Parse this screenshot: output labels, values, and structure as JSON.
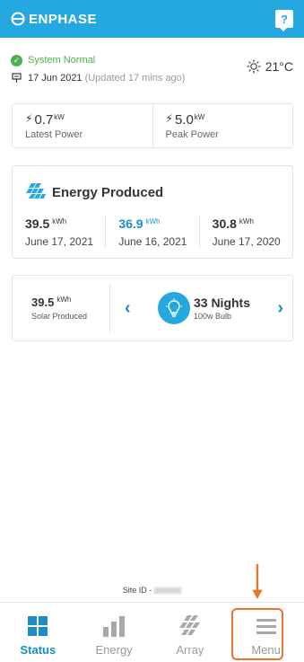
{
  "header": {
    "brand": "ENPHASE",
    "help_label": "?"
  },
  "status": {
    "text": "System Normal",
    "date": "17 Jun 2021",
    "updated": "(Updated 17 mins ago)",
    "temperature": "21°C"
  },
  "power": {
    "latest": {
      "value": "0.7",
      "unit": "kW",
      "label": "Latest Power"
    },
    "peak": {
      "value": "5.0",
      "unit": "kW",
      "label": "Peak Power"
    }
  },
  "energy": {
    "title": "Energy Produced",
    "items": [
      {
        "value": "39.5",
        "unit": "kWh",
        "date": "June 17, 2021"
      },
      {
        "value": "36.9",
        "unit": "kWh",
        "date": "June 16, 2021"
      },
      {
        "value": "30.8",
        "unit": "kWh",
        "date": "June 17, 2020"
      }
    ]
  },
  "equivalent": {
    "solar_value": "39.5",
    "solar_unit": "kWh",
    "solar_label": "Solar Produced",
    "nights": "33 Nights",
    "bulb": "100w Bulb"
  },
  "site": {
    "label": "Site ID -"
  },
  "nav": {
    "status": "Status",
    "energy": "Energy",
    "array": "Array",
    "menu": "Menu"
  },
  "colors": {
    "accent": "#25a8e0",
    "ok": "#4caf50",
    "highlight": "#e8732a"
  }
}
